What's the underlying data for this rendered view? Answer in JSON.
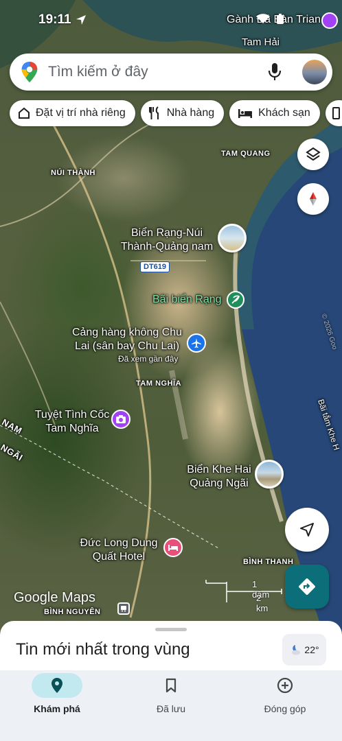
{
  "status_bar": {
    "time": "19:11"
  },
  "search": {
    "placeholder": "Tìm kiếm ở đây"
  },
  "chips": [
    {
      "label": "Đặt vị trí nhà riêng",
      "icon": "home-icon"
    },
    {
      "label": "Nhà hàng",
      "icon": "restaurant-icon"
    },
    {
      "label": "Khách sạn",
      "icon": "hotel-icon"
    }
  ],
  "map": {
    "place_labels": {
      "ganh_da_ban_trian": "Gành Đá Bàn Trian",
      "tam_hai": "Tam Hải",
      "nui_thanh": "NÚI THÀNH",
      "tam_quang": "TAM QUANG",
      "tam_nghia": "TAM NGHĨA",
      "binh_thanh": "BÌNH THANH",
      "binh_nguyen": "BÌNH NGUYÊN",
      "nam": "NAM",
      "ngai": "NGÃI",
      "bai_tam_khe": "Bãi tắm Khe H",
      "road": "DT619",
      "copyright": "© 2026 Goo"
    },
    "pois": {
      "bien_rang": "Biển Rạng-Núi Thành-Quảng nam",
      "bai_bien_rang": "Bãi biển Rạng",
      "airport": "Cảng hàng không Chu Lai (sân bay Chu Lai)",
      "airport_sub": "Đã xem gần đây",
      "tuyet_tinh_coc": "Tuyệt Tình Cốc Tam Nghĩa",
      "bien_khe_hai": "Biển Khe Hai Quảng Ngãi",
      "hotel": "Đức Long Dung Quất Hotel"
    },
    "scale": {
      "mi": "1 dặm",
      "km": "2 km"
    },
    "brand": "Google Maps"
  },
  "sheet": {
    "title": "Tin mới nhất trong vùng",
    "weather": "22°"
  },
  "nav": [
    {
      "label": "Khám phá",
      "icon": "explore-pin-icon",
      "active": true
    },
    {
      "label": "Đã lưu",
      "icon": "bookmark-icon",
      "active": false
    },
    {
      "label": "Đóng góp",
      "icon": "add-circle-icon",
      "active": false
    }
  ],
  "colors": {
    "accent": "#0b6e79",
    "nav_active": "#c2e8f0",
    "sea": "#2b4a7a"
  }
}
